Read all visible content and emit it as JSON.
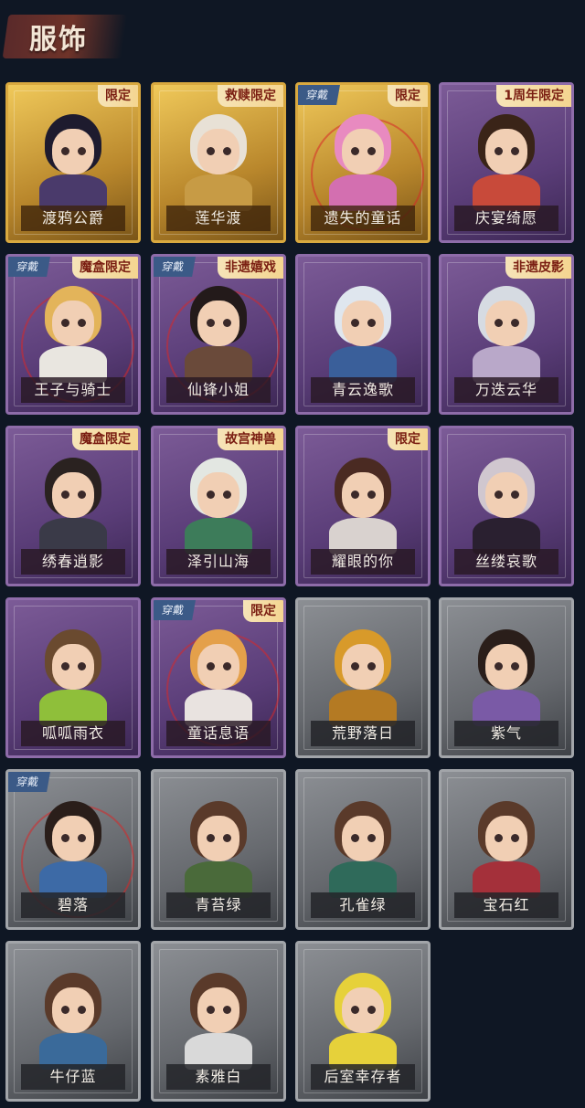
{
  "header": {
    "title": "服饰"
  },
  "costumes": [
    {
      "name": "渡鸦公爵",
      "badge": "限定",
      "equipped": "",
      "tier": "gold",
      "hair": "#1e1b2e",
      "outfit": "#4a3a6b"
    },
    {
      "name": "莲华渡",
      "badge": "救赎限定",
      "equipped": "",
      "tier": "gold",
      "hair": "#e8e1d6",
      "outfit": "#c79b45"
    },
    {
      "name": "遗失的童话",
      "badge": "限定",
      "equipped": "穿戴",
      "tier": "gold",
      "hair": "#e88ac0",
      "outfit": "#d36fb0"
    },
    {
      "name": "庆宴绮愿",
      "badge": "1周年限定",
      "equipped": "",
      "tier": "purple",
      "hair": "#3a2418",
      "outfit": "#c84a3a"
    },
    {
      "name": "王子与骑士",
      "badge": "魔盒限定",
      "equipped": "穿戴",
      "tier": "purple",
      "hair": "#e3b45a",
      "outfit": "#e9e6e0"
    },
    {
      "name": "仙锋小姐",
      "badge": "非遗嬉戏",
      "equipped": "穿戴",
      "tier": "purple",
      "hair": "#231a1a",
      "outfit": "#6a4a3a"
    },
    {
      "name": "青云逸歌",
      "badge": "",
      "equipped": "",
      "tier": "purple",
      "hair": "#dfe6ee",
      "outfit": "#3a5f9a"
    },
    {
      "name": "万迭云华",
      "badge": "非遗皮影",
      "equipped": "",
      "tier": "purple",
      "hair": "#d6dbe2",
      "outfit": "#b9a8c9"
    },
    {
      "name": "绣春逍影",
      "badge": "魔盒限定",
      "equipped": "",
      "tier": "purple",
      "hair": "#2a2220",
      "outfit": "#3a3a48"
    },
    {
      "name": "泽引山海",
      "badge": "故宫神兽",
      "equipped": "",
      "tier": "purple",
      "hair": "#e3e7e2",
      "outfit": "#3d7c5a"
    },
    {
      "name": "耀眼的你",
      "badge": "限定",
      "equipped": "",
      "tier": "purple",
      "hair": "#4a2a22",
      "outfit": "#d9d2cf"
    },
    {
      "name": "丝缕哀歌",
      "badge": "",
      "equipped": "",
      "tier": "purple",
      "hair": "#d0c7cf",
      "outfit": "#2a2030"
    },
    {
      "name": "呱呱雨衣",
      "badge": "",
      "equipped": "",
      "tier": "purple",
      "hair": "#6a4a2f",
      "outfit": "#8fbf3a"
    },
    {
      "name": "童话息语",
      "badge": "限定",
      "equipped": "穿戴",
      "tier": "purple",
      "hair": "#e4a04a",
      "outfit": "#e9e3e0"
    },
    {
      "name": "荒野落日",
      "badge": "",
      "equipped": "",
      "tier": "gray",
      "hair": "#d89a2a",
      "outfit": "#b47a23"
    },
    {
      "name": "紫气",
      "badge": "",
      "equipped": "",
      "tier": "gray",
      "hair": "#2a1e1a",
      "outfit": "#7a5aa6"
    },
    {
      "name": "碧落",
      "badge": "",
      "equipped": "穿戴",
      "tier": "gray",
      "hair": "#2a1e1a",
      "outfit": "#3d6aa6"
    },
    {
      "name": "青苔绿",
      "badge": "",
      "equipped": "",
      "tier": "gray",
      "hair": "#5a3a2a",
      "outfit": "#4a6a3a"
    },
    {
      "name": "孔雀绿",
      "badge": "",
      "equipped": "",
      "tier": "gray",
      "hair": "#5a3a2a",
      "outfit": "#2f6a5a"
    },
    {
      "name": "宝石红",
      "badge": "",
      "equipped": "",
      "tier": "gray",
      "hair": "#5a3a2a",
      "outfit": "#a4303a"
    },
    {
      "name": "牛仔蓝",
      "badge": "",
      "equipped": "",
      "tier": "gray",
      "hair": "#5a3a2a",
      "outfit": "#3a6a9a"
    },
    {
      "name": "素雅白",
      "badge": "",
      "equipped": "",
      "tier": "gray",
      "hair": "#5a3a2a",
      "outfit": "#d9d9d9"
    },
    {
      "name": "后室幸存者",
      "badge": "",
      "equipped": "",
      "tier": "gray",
      "hair": "#e6d13a",
      "outfit": "#e6d13a"
    }
  ]
}
